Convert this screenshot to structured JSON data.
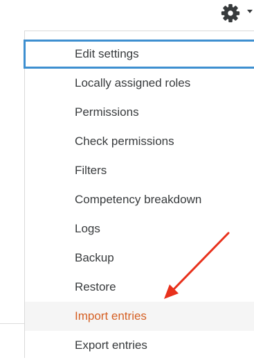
{
  "icons": {
    "gear": "gear-icon",
    "caret": "caret-down-icon",
    "annotation": "arrow-annotation"
  },
  "colors": {
    "focus_outline": "#3d8fd0",
    "hover_text": "#d55f23",
    "hover_bg": "#f5f5f5",
    "text": "#373a3c",
    "gear": "#373a3c",
    "annotation_arrow": "#e8311c"
  },
  "menu": {
    "items": [
      {
        "label": "Edit settings"
      },
      {
        "label": "Locally assigned roles"
      },
      {
        "label": "Permissions"
      },
      {
        "label": "Check permissions"
      },
      {
        "label": "Filters"
      },
      {
        "label": "Competency breakdown"
      },
      {
        "label": "Logs"
      },
      {
        "label": "Backup"
      },
      {
        "label": "Restore"
      },
      {
        "label": "Import entries"
      },
      {
        "label": "Export entries"
      }
    ]
  }
}
